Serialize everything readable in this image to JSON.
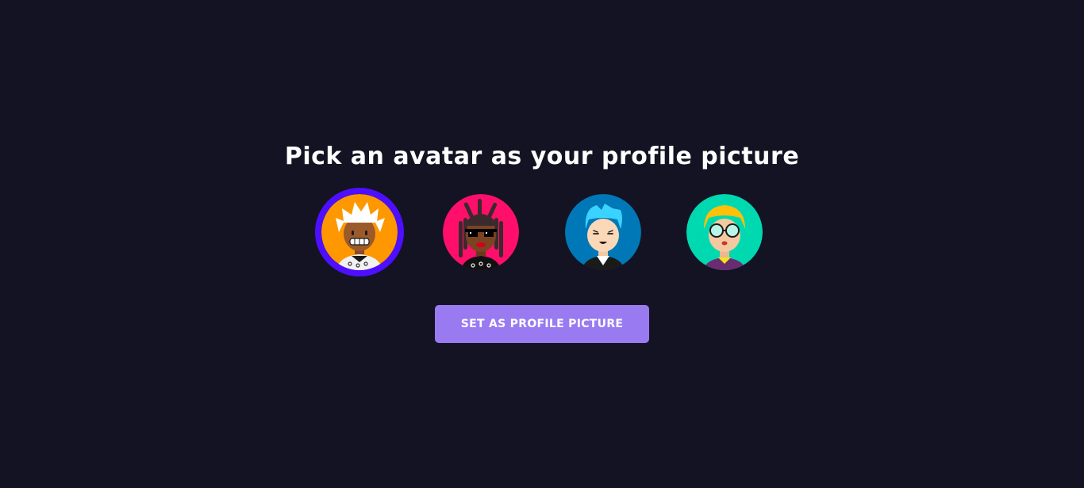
{
  "heading": "Pick an avatar as your profile picture",
  "avatars": [
    {
      "icon": "avatar-white-hair-icon",
      "selected": true,
      "bg": "#ff9800"
    },
    {
      "icon": "avatar-dreadlocks-sunglasses-icon",
      "selected": false,
      "bg": "#ff0f6a"
    },
    {
      "icon": "avatar-blue-hair-icon",
      "selected": false,
      "bg": "#0077b6"
    },
    {
      "icon": "avatar-glasses-blonde-icon",
      "selected": false,
      "bg": "#00d9b0"
    }
  ],
  "button": {
    "label": "Set as Profile Picture"
  },
  "colors": {
    "background": "#131324",
    "selected_border": "#4e0eff",
    "button": "#997af0"
  }
}
